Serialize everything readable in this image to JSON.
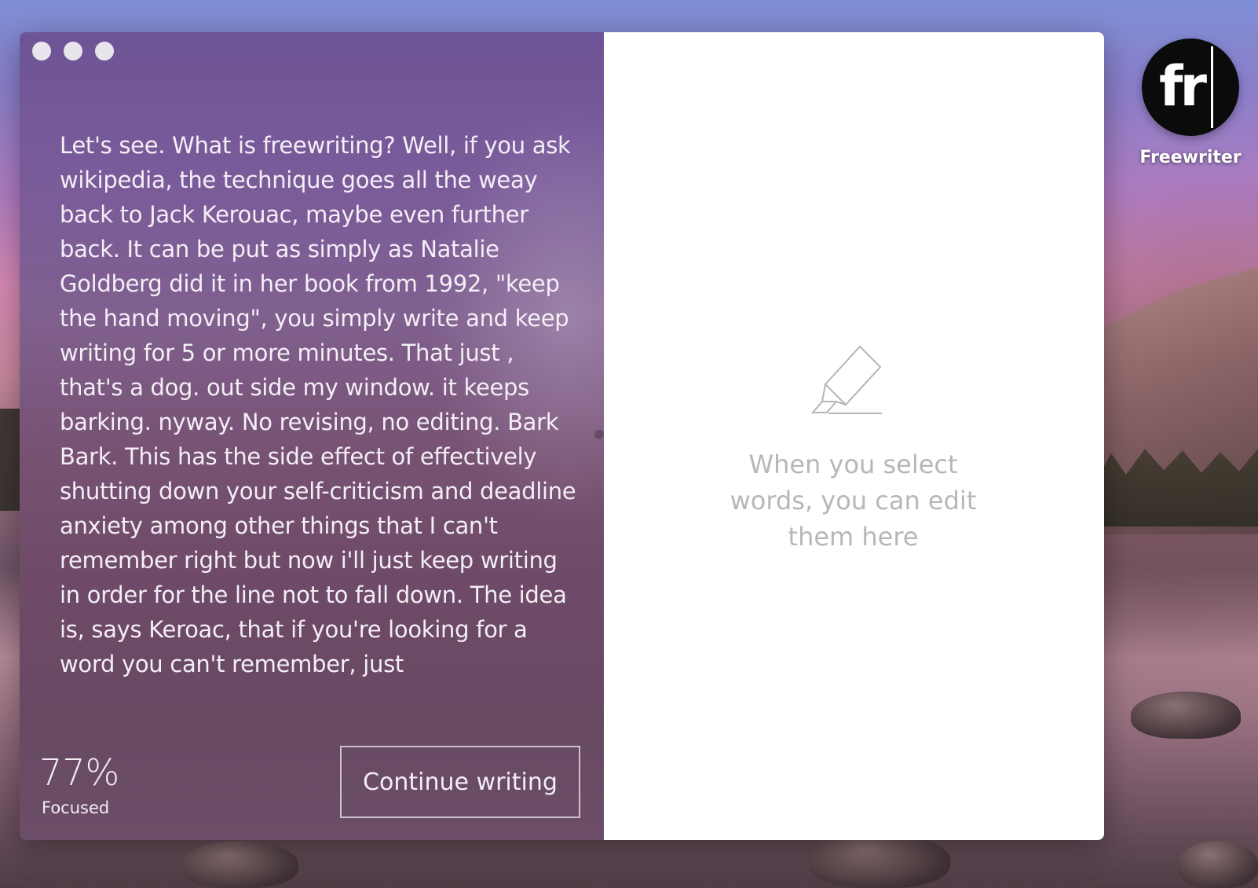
{
  "editor": {
    "text": "Let's see. What is freewriting? Well, if you ask wikipedia, the technique goes all the weay back to Jack Kerouac, maybe even further back. It can be put as simply as Natalie Goldberg did it in her book from 1992, \"keep the hand  moving\", you simply write and keep writing for 5 or more minutes. That just , that's a dog. out side my window. it keeps barking. nyway. No revising, no editing. Bark Bark. This has the side effect of effectively shutting down your self-criticism and deadline anxiety among other things that I can't remember right but now i'll just keep writing in order for the line not to fall down. The idea is, says Keroac, that if you're looking for a word you can't remember, just"
  },
  "stats": {
    "focus_value": "77%",
    "focus_label": "Focused"
  },
  "actions": {
    "continue_label": "Continue writing"
  },
  "edit_panel": {
    "icon": "highlighter-icon",
    "hint": "When you select words, you can edit them here"
  },
  "desktop": {
    "app_icon_text": "fr",
    "app_label": "Freewriter"
  },
  "colors": {
    "panel_text": "#f4eef6",
    "hint_text": "#b7b7b7",
    "icon_bg": "#0b0b0b"
  }
}
